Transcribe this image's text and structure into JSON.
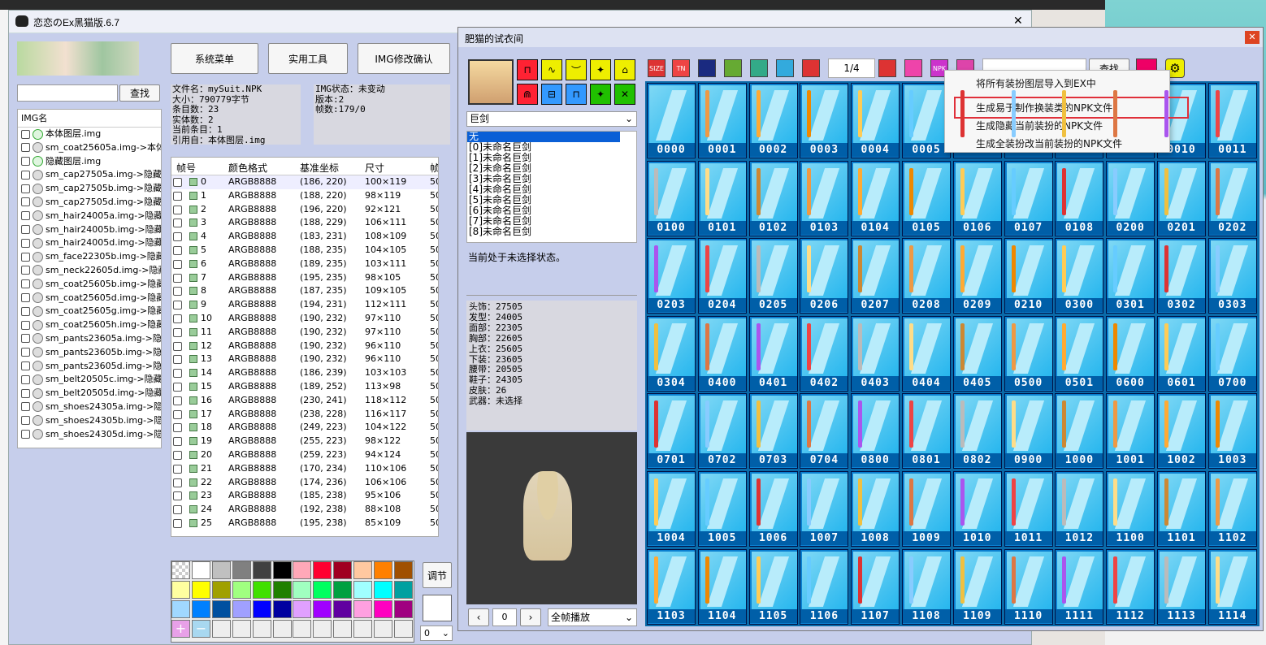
{
  "main_window": {
    "title": "恋恋のEx黑猫版.6.7",
    "close_glyph": "✕"
  },
  "main_buttons": {
    "system_menu": "系统菜单",
    "utility": "实用工具",
    "img_confirm": "IMG修改确认"
  },
  "search": {
    "value": "",
    "button": "查找"
  },
  "img_list": {
    "header": "IMG名",
    "items": [
      "本体图层.img",
      "sm_coat25605a.img->本体",
      "隐藏图层.img",
      "sm_cap27505a.img->隐藏",
      "sm_cap27505b.img->隐藏",
      "sm_cap27505d.img->隐藏",
      "sm_hair24005a.img->隐藏",
      "sm_hair24005b.img->隐藏",
      "sm_hair24005d.img->隐藏",
      "sm_face22305b.img->隐藏",
      "sm_neck22605d.img->隐藏",
      "sm_coat25605b.img->隐藏",
      "sm_coat25605d.img->隐藏",
      "sm_coat25605g.img->隐藏",
      "sm_coat25605h.img->隐藏",
      "sm_pants23605a.img->隐藏",
      "sm_pants23605b.img->隐藏",
      "sm_pants23605d.img->隐藏",
      "sm_belt20505c.img->隐藏",
      "sm_belt20505d.img->隐藏",
      "sm_shoes24305a.img->隐",
      "sm_shoes24305b.img->隐",
      "sm_shoes24305d.img->隐"
    ]
  },
  "file_info": [
    "文件名：mySuit.NPK",
    "大小：790779字节",
    "条目数：23",
    "实体数：2",
    "当前条目：1",
    "引用自：本体图层.img"
  ],
  "img_info": [
    "IMG状态：未变动",
    "版本:2",
    "帧数:179/0"
  ],
  "frame_table": {
    "headers": [
      "帧号",
      "颜色格式",
      "基准坐标",
      "尺寸",
      "帧"
    ],
    "rows": [
      [
        "0",
        "ARGB8888",
        "(186, 220)",
        "100×119",
        "50"
      ],
      [
        "1",
        "ARGB8888",
        "(188, 220)",
        "98×119",
        "50"
      ],
      [
        "2",
        "ARGB8888",
        "(196, 220)",
        "92×121",
        "50"
      ],
      [
        "3",
        "ARGB8888",
        "(188, 229)",
        "106×111",
        "50"
      ],
      [
        "4",
        "ARGB8888",
        "(183, 231)",
        "108×109",
        "50"
      ],
      [
        "5",
        "ARGB8888",
        "(188, 235)",
        "104×105",
        "50"
      ],
      [
        "6",
        "ARGB8888",
        "(189, 235)",
        "103×111",
        "50"
      ],
      [
        "7",
        "ARGB8888",
        "(195, 235)",
        "98×105",
        "50"
      ],
      [
        "8",
        "ARGB8888",
        "(187, 235)",
        "109×105",
        "50"
      ],
      [
        "9",
        "ARGB8888",
        "(194, 231)",
        "112×111",
        "50"
      ],
      [
        "10",
        "ARGB8888",
        "(190, 232)",
        "97×110",
        "50"
      ],
      [
        "11",
        "ARGB8888",
        "(190, 232)",
        "97×110",
        "50"
      ],
      [
        "12",
        "ARGB8888",
        "(190, 232)",
        "96×110",
        "50"
      ],
      [
        "13",
        "ARGB8888",
        "(190, 232)",
        "96×110",
        "50"
      ],
      [
        "14",
        "ARGB8888",
        "(186, 239)",
        "103×103",
        "50"
      ],
      [
        "15",
        "ARGB8888",
        "(189, 252)",
        "113×98",
        "50"
      ],
      [
        "16",
        "ARGB8888",
        "(230, 241)",
        "118×112",
        "50"
      ],
      [
        "17",
        "ARGB8888",
        "(238, 228)",
        "116×117",
        "50"
      ],
      [
        "18",
        "ARGB8888",
        "(249, 223)",
        "104×122",
        "50"
      ],
      [
        "19",
        "ARGB8888",
        "(255, 223)",
        "98×122",
        "50"
      ],
      [
        "20",
        "ARGB8888",
        "(259, 223)",
        "94×124",
        "50"
      ],
      [
        "21",
        "ARGB8888",
        "(170, 234)",
        "110×106",
        "50"
      ],
      [
        "22",
        "ARGB8888",
        "(174, 236)",
        "106×106",
        "50"
      ],
      [
        "23",
        "ARGB8888",
        "(185, 238)",
        "95×106",
        "50"
      ],
      [
        "24",
        "ARGB8888",
        "(192, 238)",
        "88×108",
        "50"
      ],
      [
        "25",
        "ARGB8888",
        "(195, 238)",
        "85×109",
        "50"
      ]
    ]
  },
  "palette": {
    "colors": [
      "#ffffff",
      "#c0c0c0",
      "#808080",
      "#404040",
      "#000000",
      "#ffa8b8",
      "#ff0030",
      "#a00020",
      "#ffc8a0",
      "#ff8000",
      "#a05000",
      "#ffffa0",
      "#ffff00",
      "#a0a000",
      "#a0ff80",
      "#40e000",
      "#208000",
      "#a0ffc0",
      "#00ff60",
      "#00a040",
      "#a0ffff",
      "#00ffff",
      "#00a0a0",
      "#a0d8ff",
      "#0080ff",
      "#0050a0",
      "#a0a0ff",
      "#0000ff",
      "#0000a0",
      "#e0a0ff",
      "#a000ff",
      "#6000a0",
      "#ffa0e0",
      "#ff00c0",
      "#a00080"
    ],
    "adjust": "调节",
    "select_value": "0"
  },
  "fitting_room": {
    "title": "肥猫的试衣间",
    "close_glyph": "✕",
    "category": "巨剑",
    "page": "1/4",
    "search_button": "查找",
    "part_list": [
      "无",
      "[0]未命名巨剑",
      "[1]未命名巨剑",
      "[2]未命名巨剑",
      "[3]未命名巨剑",
      "[4]未命名巨剑",
      "[5]未命名巨剑",
      "[6]未命名巨剑",
      "[7]未命名巨剑",
      "[8]未命名巨剑"
    ],
    "status": "当前处于未选择状态。",
    "equip": [
      "头饰：27505",
      "发型：24005",
      "面部：22305",
      "胸部：22605",
      "上衣：25605",
      "下装：23605",
      "腰带：20505",
      "鞋子：24305",
      "皮肤：26",
      "武器：未选择"
    ],
    "frame_value": "0",
    "play_mode": "全帧播放",
    "toolbar_labels": [
      "SIZE",
      "TN",
      "",
      "",
      "",
      "",
      "",
      "",
      "",
      "NPK",
      ""
    ],
    "tiles": [
      "0000",
      "0001",
      "0002",
      "0003",
      "0004",
      "0005",
      "0006",
      "0007",
      "0008",
      "0009",
      "0010",
      "0011",
      "0100",
      "0101",
      "0102",
      "0103",
      "0104",
      "0105",
      "0106",
      "0107",
      "0108",
      "0200",
      "0201",
      "0202",
      "0203",
      "0204",
      "0205",
      "0206",
      "0207",
      "0208",
      "0209",
      "0210",
      "0300",
      "0301",
      "0302",
      "0303",
      "0304",
      "0400",
      "0401",
      "0402",
      "0403",
      "0404",
      "0405",
      "0500",
      "0501",
      "0600",
      "0601",
      "0700",
      "0701",
      "0702",
      "0703",
      "0704",
      "0800",
      "0801",
      "0802",
      "0900",
      "1000",
      "1001",
      "1002",
      "1003",
      "1004",
      "1005",
      "1006",
      "1007",
      "1008",
      "1009",
      "1010",
      "1011",
      "1012",
      "1100",
      "1101",
      "1102",
      "1103",
      "1104",
      "1105",
      "1106",
      "1107",
      "1108",
      "1109",
      "1110",
      "1111",
      "1112",
      "1113",
      "1114"
    ]
  },
  "context_menu": {
    "items": [
      "将所有装扮图层导入到EX中",
      "生成易于制作换装类的NPK文件",
      "生成隐藏当前装扮的NPK文件",
      "生成全装扮改当前装扮的NPK文件"
    ],
    "highlight_color": "#e0303a"
  }
}
